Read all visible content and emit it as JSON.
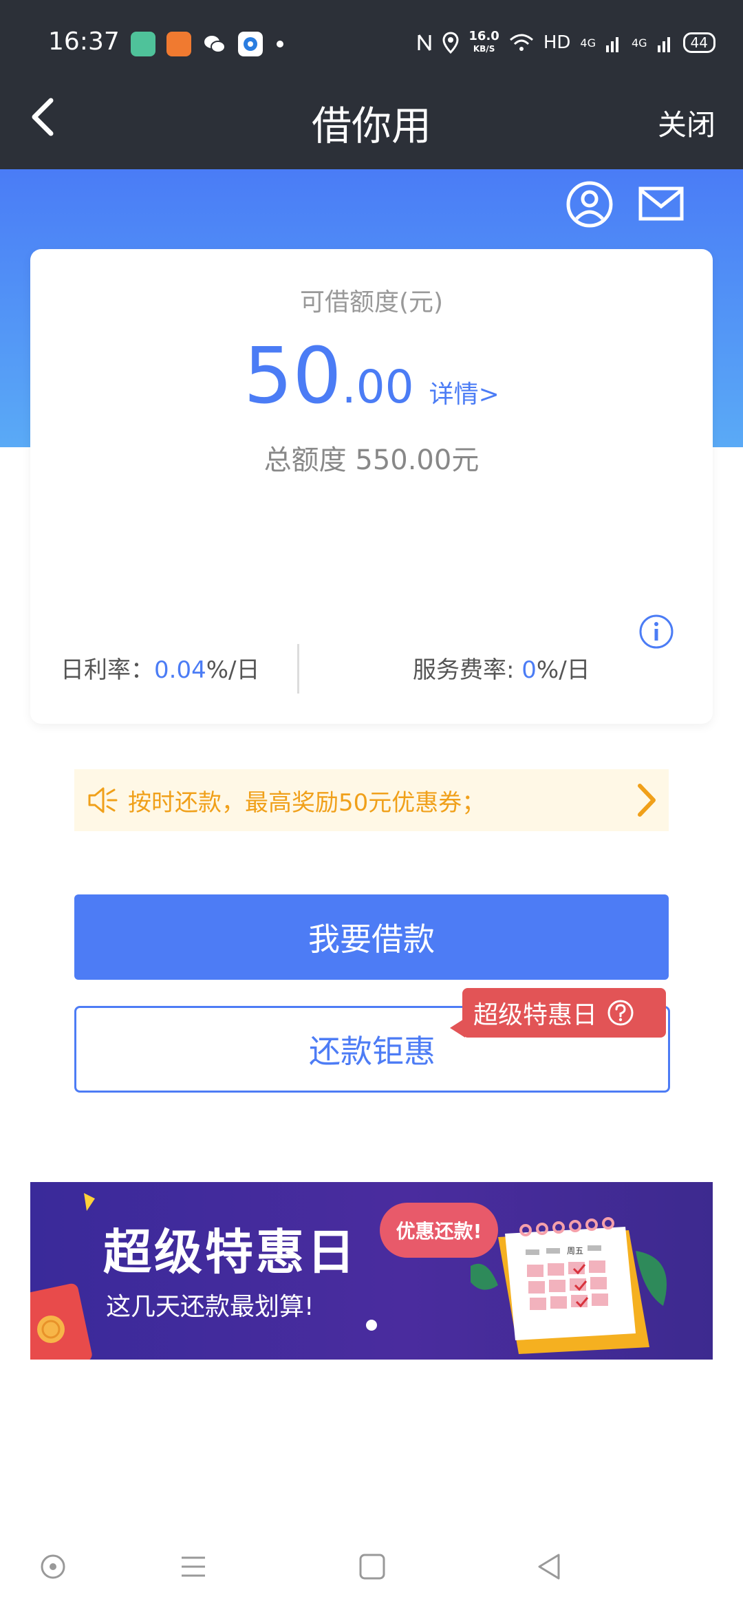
{
  "status_bar": {
    "time": "16:37",
    "speed_value": "16.0",
    "speed_unit": "KB/S",
    "hd": "HD",
    "network1": "4G",
    "network2": "4G",
    "battery": "44",
    "app_icons": [
      "green-app-icon",
      "uc-browser-icon",
      "wechat-icon",
      "blue-circle-app-icon"
    ]
  },
  "header": {
    "title": "借你用",
    "close_label": "关闭",
    "icons": [
      "back-arrow-icon",
      "user-profile-icon",
      "mail-icon"
    ]
  },
  "card": {
    "credit_label": "可借额度(元)",
    "amount_int": "50",
    "amount_dec": ".00",
    "detail_link": "详情>",
    "total_text": "总额度 550.00元",
    "daily_rate_label": "日利率：",
    "daily_rate_value": "0.04",
    "daily_rate_unit": "%/日",
    "service_rate_label": "服务费率: ",
    "service_rate_value": "0",
    "service_rate_unit": "%/日"
  },
  "notice": {
    "text": "按时还款，最高奖励50元优惠券；"
  },
  "buttons": {
    "borrow": "我要借款",
    "repay": "还款钜惠",
    "special_tag": "超级特惠日"
  },
  "banner": {
    "title": "超级特惠日",
    "subtitle": "这几天还款最划算!",
    "bubble": "优惠还款!",
    "calendar_label": "周五"
  },
  "colors": {
    "primary": "#4d7cf5",
    "dark_bar": "#2c3038",
    "notice_text": "#f0a01a",
    "tag_red": "#e25456"
  }
}
